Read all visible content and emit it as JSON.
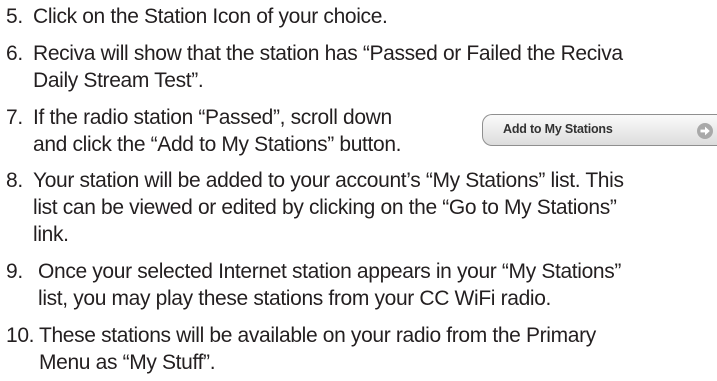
{
  "steps": [
    {
      "number": "5.",
      "lines": [
        "Click on the Station Icon of your choice."
      ]
    },
    {
      "number": "6.",
      "lines": [
        "Reciva will show that the station has “Passed or Failed the Reciva",
        "Daily Stream Test”."
      ]
    },
    {
      "number": "7.",
      "lines": [
        "If the radio station “Passed”, scroll down",
        "and click the “Add to My Stations” button."
      ]
    },
    {
      "number": "8.",
      "lines": [
        "Your station will be added to your account’s “My Stations” list. This",
        "list can be viewed or edited by clicking on the “Go to My Stations”",
        "link."
      ]
    },
    {
      "number": "9.",
      "lines": [
        "Once your selected Internet station appears in your “My Stations”",
        "list, you may play these stations from your CC WiFi radio."
      ]
    },
    {
      "number": "10.",
      "lines": [
        "These stations will be available on your radio from the Primary",
        "Menu as “My Stuff”."
      ]
    }
  ],
  "add_button": {
    "label": "Add to My Stations",
    "icon": "arrow-right-circle-icon"
  },
  "colors": {
    "text": "#231f20",
    "button_border": "#8f8f8f",
    "button_icon": "#a9a9a9"
  }
}
